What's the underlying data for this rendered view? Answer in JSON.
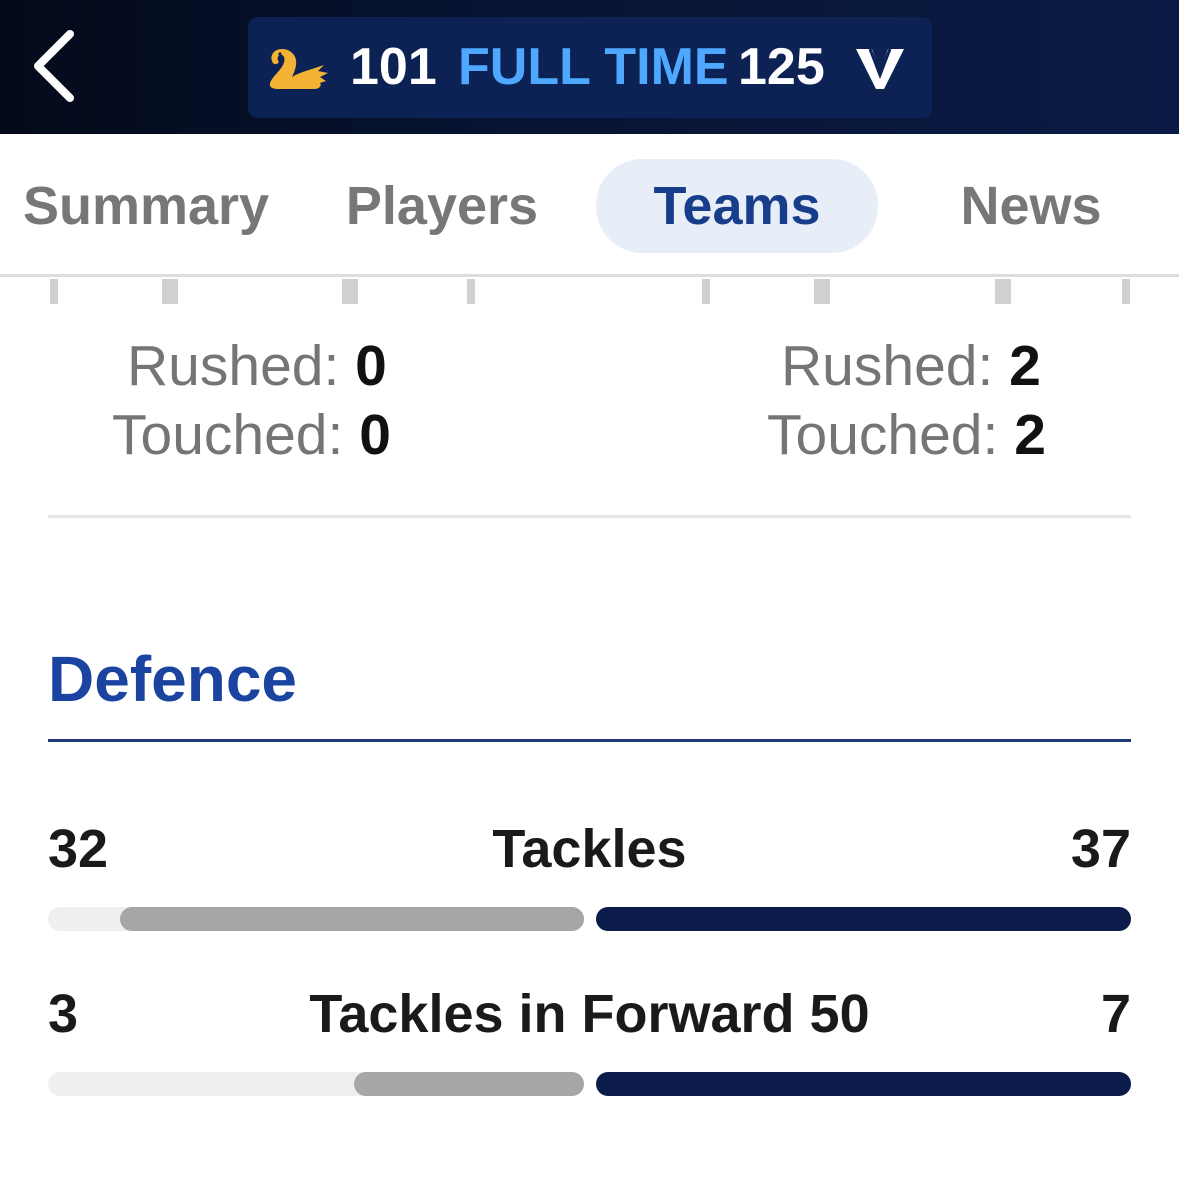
{
  "header": {
    "home_score": "101",
    "status": "FULL TIME",
    "away_score": "125",
    "home_logo_icon": "swan-icon",
    "away_logo_icon": "v-logo-icon",
    "home_logo_color": "#f2b233",
    "status_color": "#4fa8ff"
  },
  "tabs": [
    {
      "label": "Summary",
      "active": false
    },
    {
      "label": "Players",
      "active": false
    },
    {
      "label": "Teams",
      "active": true
    },
    {
      "label": "News",
      "active": false
    }
  ],
  "rushed_touched": {
    "home": {
      "rushed_label": "Rushed:",
      "rushed_value": "0",
      "touched_label": "Touched:",
      "touched_value": "0"
    },
    "away": {
      "rushed_label": "Rushed:",
      "rushed_value": "2",
      "touched_label": "Touched:",
      "touched_value": "2"
    }
  },
  "defence": {
    "title": "Defence",
    "stats": [
      {
        "label": "Tackles",
        "home": "32",
        "away": "37",
        "home_fraction": 0.865,
        "away_fraction": 1.0
      },
      {
        "label": "Tackles in Forward 50",
        "home": "3",
        "away": "7",
        "home_fraction": 0.429,
        "away_fraction": 1.0
      }
    ]
  },
  "colors": {
    "accent": "#1b43a0",
    "home_bar": "#a6a6a6",
    "away_bar": "#0c1c4a"
  }
}
